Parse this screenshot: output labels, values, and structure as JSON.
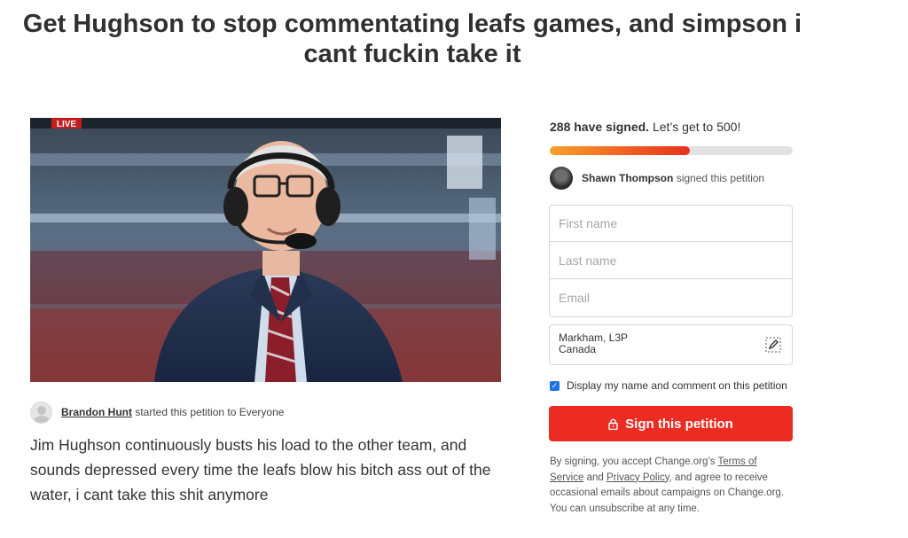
{
  "petition": {
    "title": "Get Hughson to stop commentating leafs games, and simpson i cant fuckin take it",
    "hero_badge": "LIVE",
    "starter_name": "Brandon Hunt",
    "starter_suffix": "started this petition to Everyone",
    "description": "Jim Hughson continuously busts his load to the other team, and sounds depressed every time the leafs blow his bitch ass out of the water, i cant take this shit anymore"
  },
  "signatures": {
    "signed_bold": "288 have signed.",
    "goal_text": "Let’s get to 500!",
    "signed_count": 288,
    "goal_count": 500,
    "bar_colors": {
      "start": "#f7a02a",
      "end": "#e8321e",
      "track": "#e1e1e1"
    },
    "recent_signer_name": "Shawn Thompson",
    "recent_signer_suffix": "signed this petition"
  },
  "form": {
    "first_name_placeholder": "First name",
    "last_name_placeholder": "Last name",
    "email_placeholder": "Email",
    "location_line1": "Markham, L3P",
    "location_line2": "Canada",
    "location_edit_icon": "pencil-edit-icon",
    "display_checkbox_label": "Display my name and comment on this petition",
    "display_checked": true,
    "sign_button_label": "Sign this petition",
    "sign_button_icon": "lock-icon",
    "sign_button_color": "#ec2c22"
  },
  "legal": {
    "prefix": "By signing, you accept Change.org’s",
    "terms_link": "Terms of Service",
    "and": "and",
    "privacy_link": "Privacy Policy",
    "suffix": ", and agree to receive occasional emails about campaigns on Change.org. You can unsubscribe at any time."
  }
}
